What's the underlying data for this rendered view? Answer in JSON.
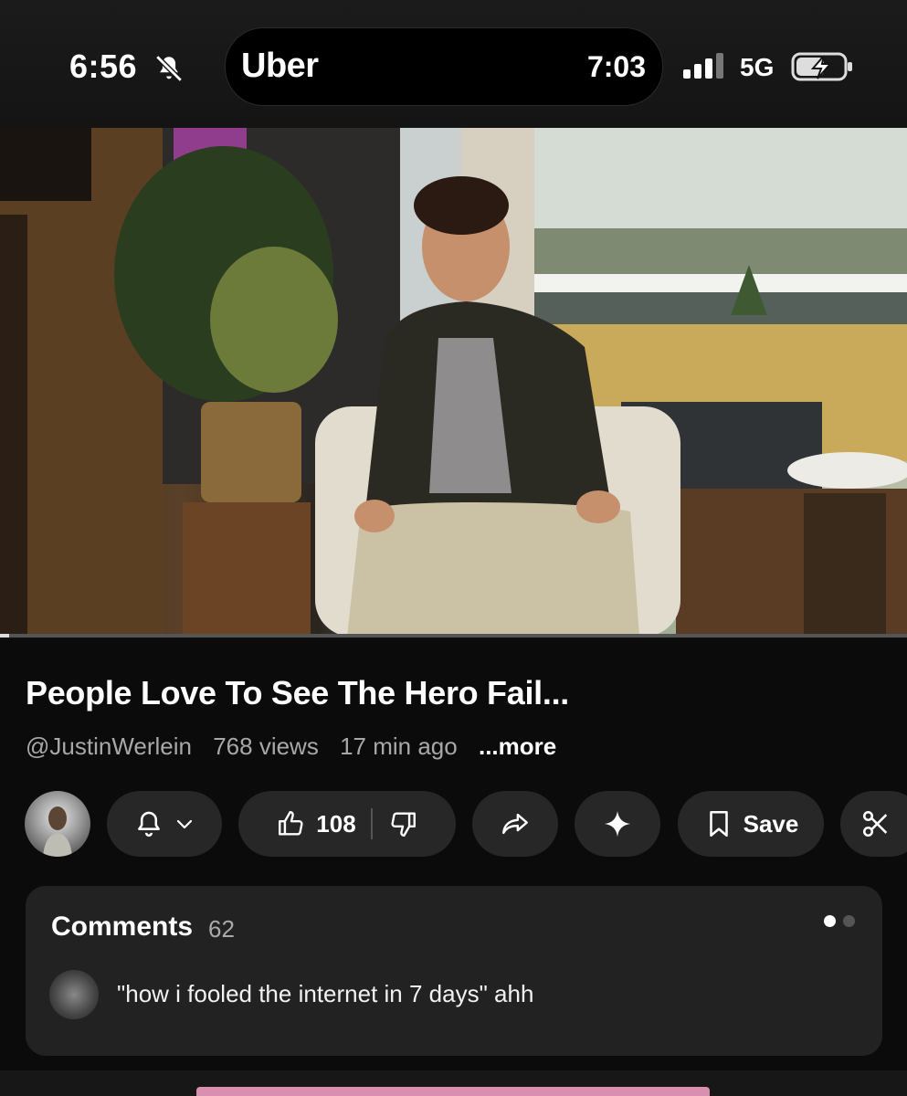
{
  "status_bar": {
    "time": "6:56",
    "live_activity_app": "Uber",
    "live_activity_time": "7:03",
    "network": "5G"
  },
  "video": {
    "title": "People Love To See The Hero Fail...",
    "channel": "@JustinWerlein",
    "views": "768 views",
    "age": "17 min ago",
    "more_label": "...more",
    "progress_fraction": 0.01
  },
  "actions": {
    "like_count": "108",
    "save_label": "Save"
  },
  "comments": {
    "title": "Comments",
    "count": "62",
    "top_comment": "\"how i fooled the internet in 7 days\" ahh"
  }
}
